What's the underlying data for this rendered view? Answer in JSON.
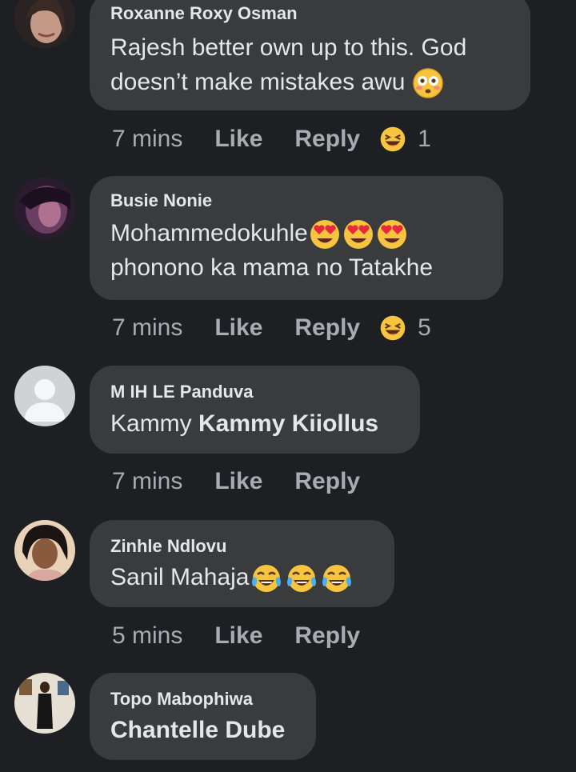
{
  "comments": [
    {
      "author": "Roxanne Roxy Osman",
      "line1": "Rajesh better own up to this. God",
      "line2": "doesn’t make mistakes awu",
      "line2_emoji": "flushed-face-emoji",
      "time": "7 mins",
      "like": "Like",
      "reply": "Reply",
      "reaction": "laughing-emoji",
      "reaction_count": "1"
    },
    {
      "author": "Busie Nonie",
      "line1": "Mohammedokuhle",
      "line1_emoji": "heart-eyes-emoji",
      "line2": "phonono  ka mama no Tatakhe",
      "time": "7 mins",
      "like": "Like",
      "reply": "Reply",
      "reaction": "laughing-emoji",
      "reaction_count": "5"
    },
    {
      "author": "M IH LE Panduva",
      "line1": "Kammy ",
      "mention": "Kammy Kiiollus",
      "time": "7 mins",
      "like": "Like",
      "reply": "Reply"
    },
    {
      "author": "Zinhle Ndlovu",
      "line1": "Sanil Mahaja",
      "line1_emoji": "tears-of-joy-emoji",
      "time": "5 mins",
      "like": "Like",
      "reply": "Reply"
    },
    {
      "author": "Topo Mabophiwa",
      "mention": "Chantelle Dube"
    }
  ],
  "colors": {
    "background": "#1e1f22",
    "bubble": "#3a3b3c",
    "text": "#e4e6eb",
    "meta": "#a8abaf"
  }
}
